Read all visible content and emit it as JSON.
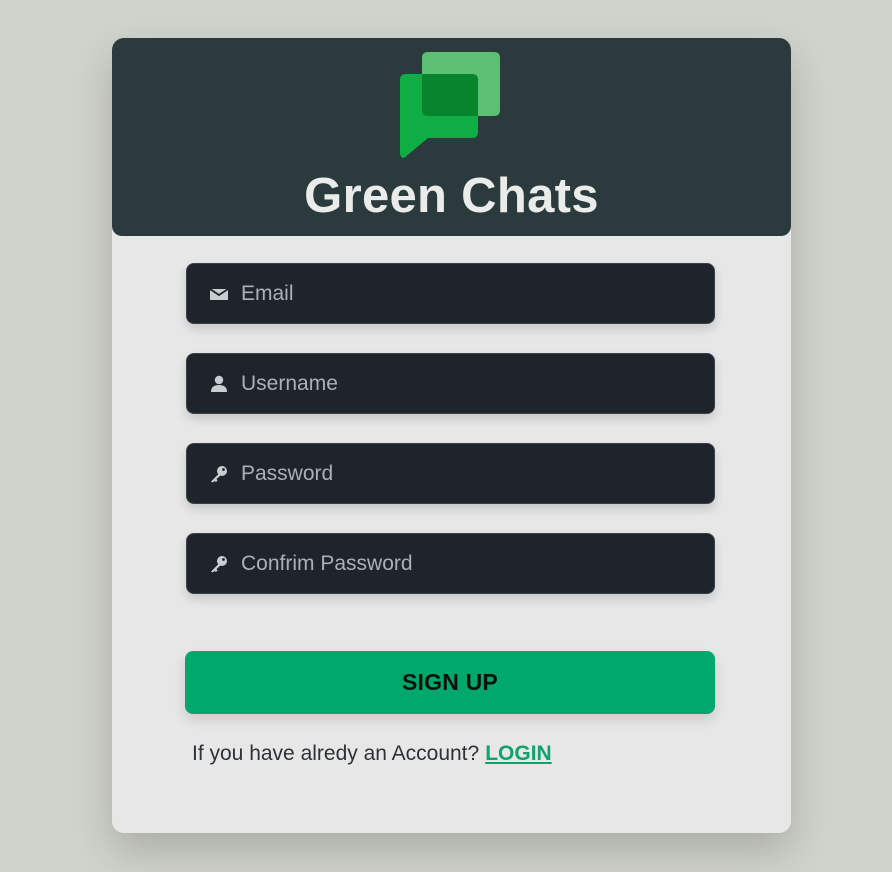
{
  "app": {
    "title": "Green Chats",
    "logo_icon": "chat-bubbles-icon"
  },
  "form": {
    "fields": [
      {
        "name": "email",
        "icon": "envelope-icon",
        "placeholder": "Email",
        "type": "email"
      },
      {
        "name": "username",
        "icon": "user-icon",
        "placeholder": "Username",
        "type": "text"
      },
      {
        "name": "password",
        "icon": "key-icon",
        "placeholder": "Password",
        "type": "password"
      },
      {
        "name": "confirm_password",
        "icon": "key-icon",
        "placeholder": "Confrim Password",
        "type": "password"
      }
    ],
    "submit_label": "SIGN UP"
  },
  "footer": {
    "prompt": "If you have alredy an Account?",
    "link_label": "LOGIN"
  },
  "colors": {
    "background": "#d0d3cb",
    "header": "#2b3b3d",
    "card": "#e7e7e7",
    "field": "#1f242a",
    "accent": "#00a86b",
    "link": "#12a36c"
  }
}
